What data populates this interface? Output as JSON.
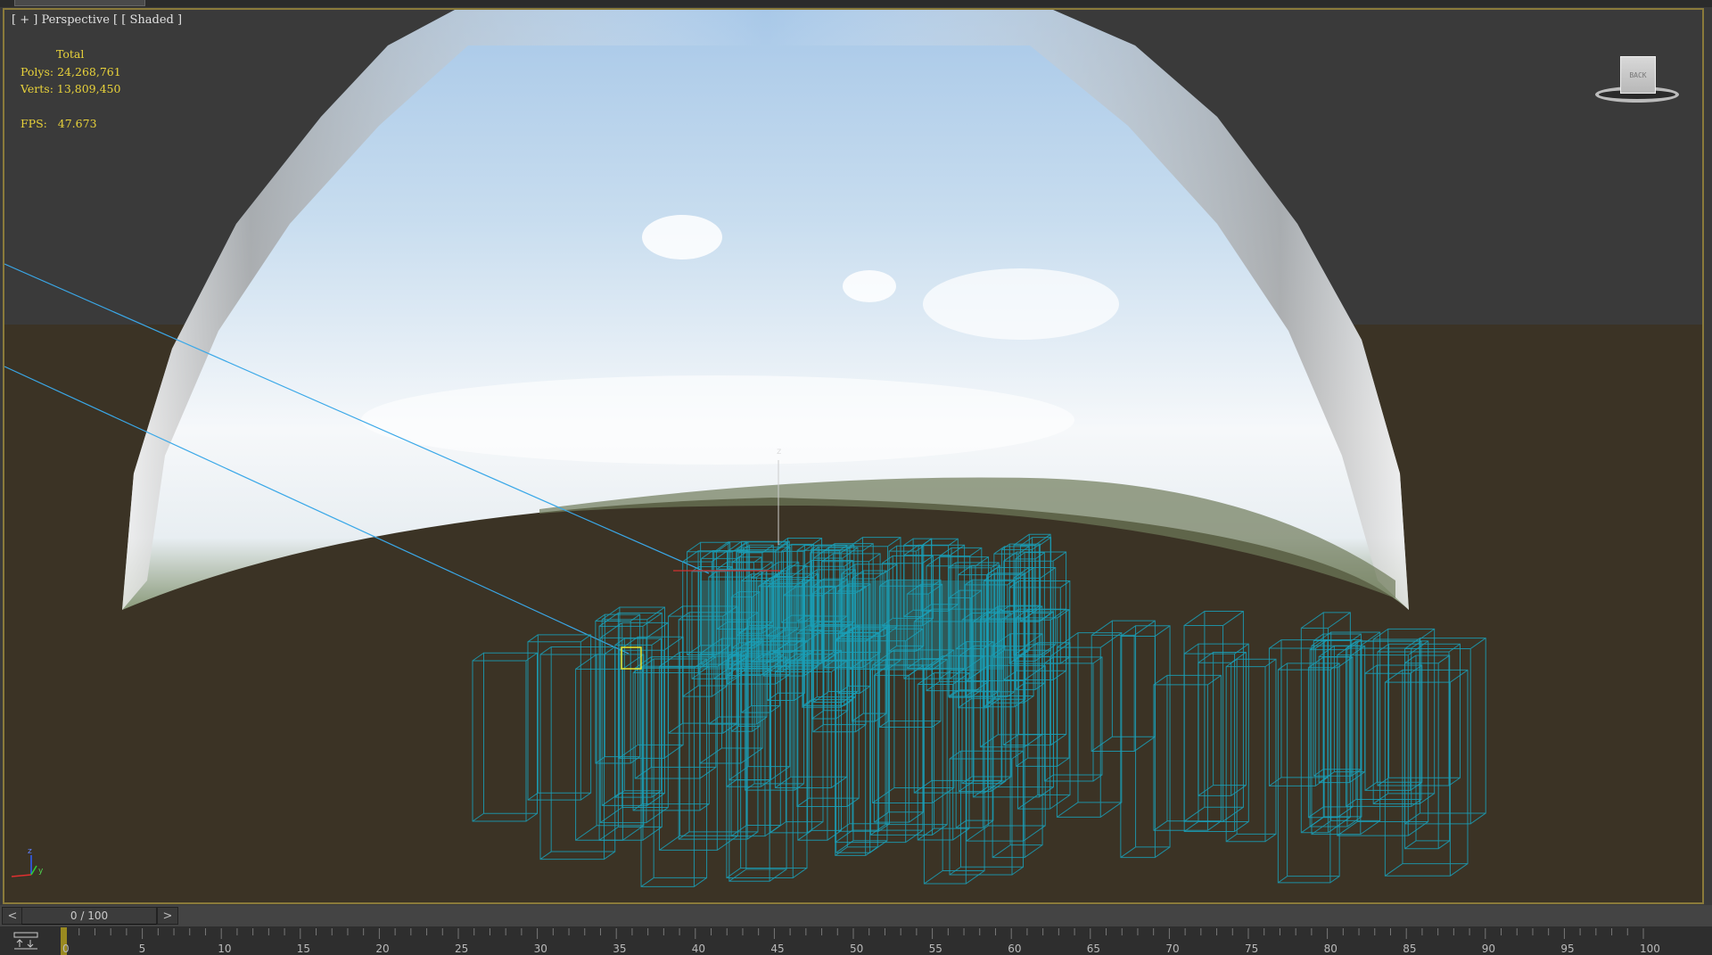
{
  "viewport": {
    "label_plus": "[ + ]",
    "label_view": "Perspective",
    "label_shading": "[ Shaded ]",
    "stats": {
      "header": "Total",
      "polys_label": "Polys:",
      "polys_value": "24,268,761",
      "verts_label": "Verts:",
      "verts_value": "13,809,450",
      "fps_label": "FPS:",
      "fps_value": "47.673"
    },
    "viewcube_face": "BACK",
    "gizmo_axis": "z",
    "axis_tripod": {
      "z": "z",
      "y": "y",
      "x": "x"
    }
  },
  "timeline": {
    "prev": "<",
    "next": ">",
    "frame_display": "0 / 100",
    "current_frame": 0,
    "total_frames": 100,
    "tick_labels": [
      "0",
      "5",
      "10",
      "15",
      "20",
      "25",
      "30",
      "35",
      "40",
      "45",
      "50",
      "55",
      "60",
      "65",
      "70",
      "75",
      "80",
      "85",
      "90",
      "95",
      "100"
    ]
  },
  "colors": {
    "wire": "#1aa0b8",
    "stats": "#e8d23a",
    "ground": "#3b3325",
    "frame": "#8a7a3a"
  }
}
